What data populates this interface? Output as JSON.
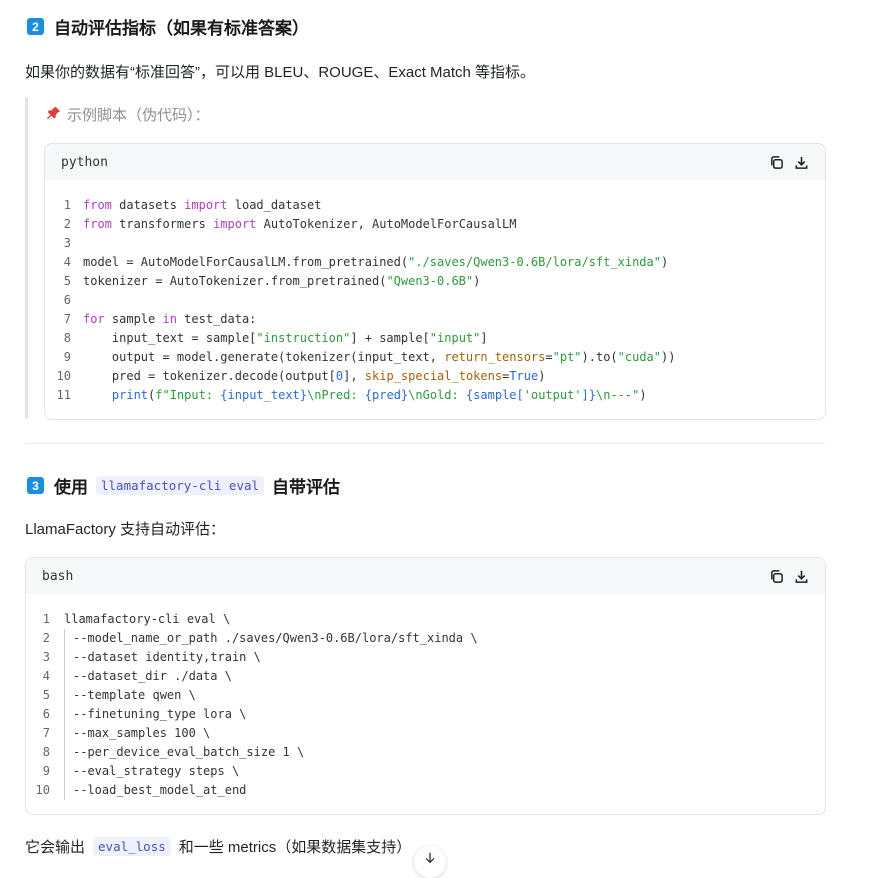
{
  "section2": {
    "badge": "2",
    "title": "自动评估指标（如果有标准答案）",
    "desc": "如果你的数据有“标准回答”，可以用 BLEU、ROUGE、Exact Match 等指标。",
    "quote_label": "示例脚本（伪代码）：",
    "code_lang": "python"
  },
  "python_code": [
    {
      "n": "1",
      "tokens": [
        [
          "k",
          "from"
        ],
        [
          "p",
          " datasets "
        ],
        [
          "k",
          "import"
        ],
        [
          "p",
          " load_dataset"
        ]
      ]
    },
    {
      "n": "2",
      "tokens": [
        [
          "k",
          "from"
        ],
        [
          "p",
          " transformers "
        ],
        [
          "k",
          "import"
        ],
        [
          "p",
          " AutoTokenizer, AutoModelForCausalLM"
        ]
      ]
    },
    {
      "n": "3",
      "tokens": []
    },
    {
      "n": "4",
      "tokens": [
        [
          "p",
          "model = AutoModelForCausalLM.from_pretrained("
        ],
        [
          "s",
          "\"./saves/Qwen3-0.6B/lora/sft_xinda\""
        ],
        [
          "p",
          ")"
        ]
      ]
    },
    {
      "n": "5",
      "tokens": [
        [
          "p",
          "tokenizer = AutoTokenizer.from_pretrained("
        ],
        [
          "s",
          "\"Qwen3-0.6B\""
        ],
        [
          "p",
          ")"
        ]
      ]
    },
    {
      "n": "6",
      "tokens": []
    },
    {
      "n": "7",
      "tokens": [
        [
          "k",
          "for"
        ],
        [
          "p",
          " sample "
        ],
        [
          "k",
          "in"
        ],
        [
          "p",
          " test_data:"
        ]
      ]
    },
    {
      "n": "8",
      "tokens": [
        [
          "p",
          "    input_text = sample["
        ],
        [
          "s",
          "\"instruction\""
        ],
        [
          "p",
          "] + sample["
        ],
        [
          "s",
          "\"input\""
        ],
        [
          "p",
          "]"
        ]
      ]
    },
    {
      "n": "9",
      "tokens": [
        [
          "p",
          "    output = model.generate(tokenizer(input_text, "
        ],
        [
          "a",
          "return_tensors"
        ],
        [
          "p",
          "="
        ],
        [
          "s",
          "\"pt\""
        ],
        [
          "p",
          ").to("
        ],
        [
          "s",
          "\"cuda\""
        ],
        [
          "p",
          "))"
        ]
      ]
    },
    {
      "n": "10",
      "tokens": [
        [
          "p",
          "    pred = tokenizer.decode(output["
        ],
        [
          "b",
          "0"
        ],
        [
          "p",
          "], "
        ],
        [
          "a",
          "skip_special_tokens"
        ],
        [
          "p",
          "="
        ],
        [
          "b",
          "True"
        ],
        [
          "p",
          ")"
        ]
      ]
    },
    {
      "n": "11",
      "tokens": [
        [
          "f",
          "    print"
        ],
        [
          "p",
          "("
        ],
        [
          "s",
          "f\"Input: "
        ],
        [
          "b",
          "{input_text}"
        ],
        [
          "s",
          "\\nPred: "
        ],
        [
          "b",
          "{pred}"
        ],
        [
          "s",
          "\\nGold: "
        ],
        [
          "b",
          "{sample["
        ],
        [
          "s",
          "'output'"
        ],
        [
          "b",
          "]}"
        ],
        [
          "s",
          "\\n---\""
        ],
        [
          "p",
          ")"
        ]
      ]
    }
  ],
  "section3": {
    "badge": "3",
    "title_pre": "使用",
    "title_code": "llamafactory-cli eval",
    "title_post": "自带评估",
    "desc": "LlamaFactory 支持自动评估：",
    "code_lang": "bash"
  },
  "bash_code": [
    {
      "n": "1",
      "text": "llamafactory-cli eval \\"
    },
    {
      "n": "2",
      "text": "  --model_name_or_path ./saves/Qwen3-0.6B/lora/sft_xinda \\"
    },
    {
      "n": "3",
      "text": "  --dataset identity,train \\"
    },
    {
      "n": "4",
      "text": "  --dataset_dir ./data \\"
    },
    {
      "n": "5",
      "text": "  --template qwen \\"
    },
    {
      "n": "6",
      "text": "  --finetuning_type lora \\"
    },
    {
      "n": "7",
      "text": "  --max_samples 100 \\"
    },
    {
      "n": "8",
      "text": "  --per_device_eval_batch_size 1 \\"
    },
    {
      "n": "9",
      "text": "  --eval_strategy steps \\"
    },
    {
      "n": "10",
      "text": "  --load_best_model_at_end"
    }
  ],
  "footer": {
    "pre": "它会输出",
    "code": "eval_loss",
    "post": "和一些 metrics（如果数据集支持）"
  },
  "icons": {
    "copy": "copy-icon",
    "download": "download-icon",
    "pin": "pushpin-icon",
    "scroll": "arrow-down-icon"
  }
}
